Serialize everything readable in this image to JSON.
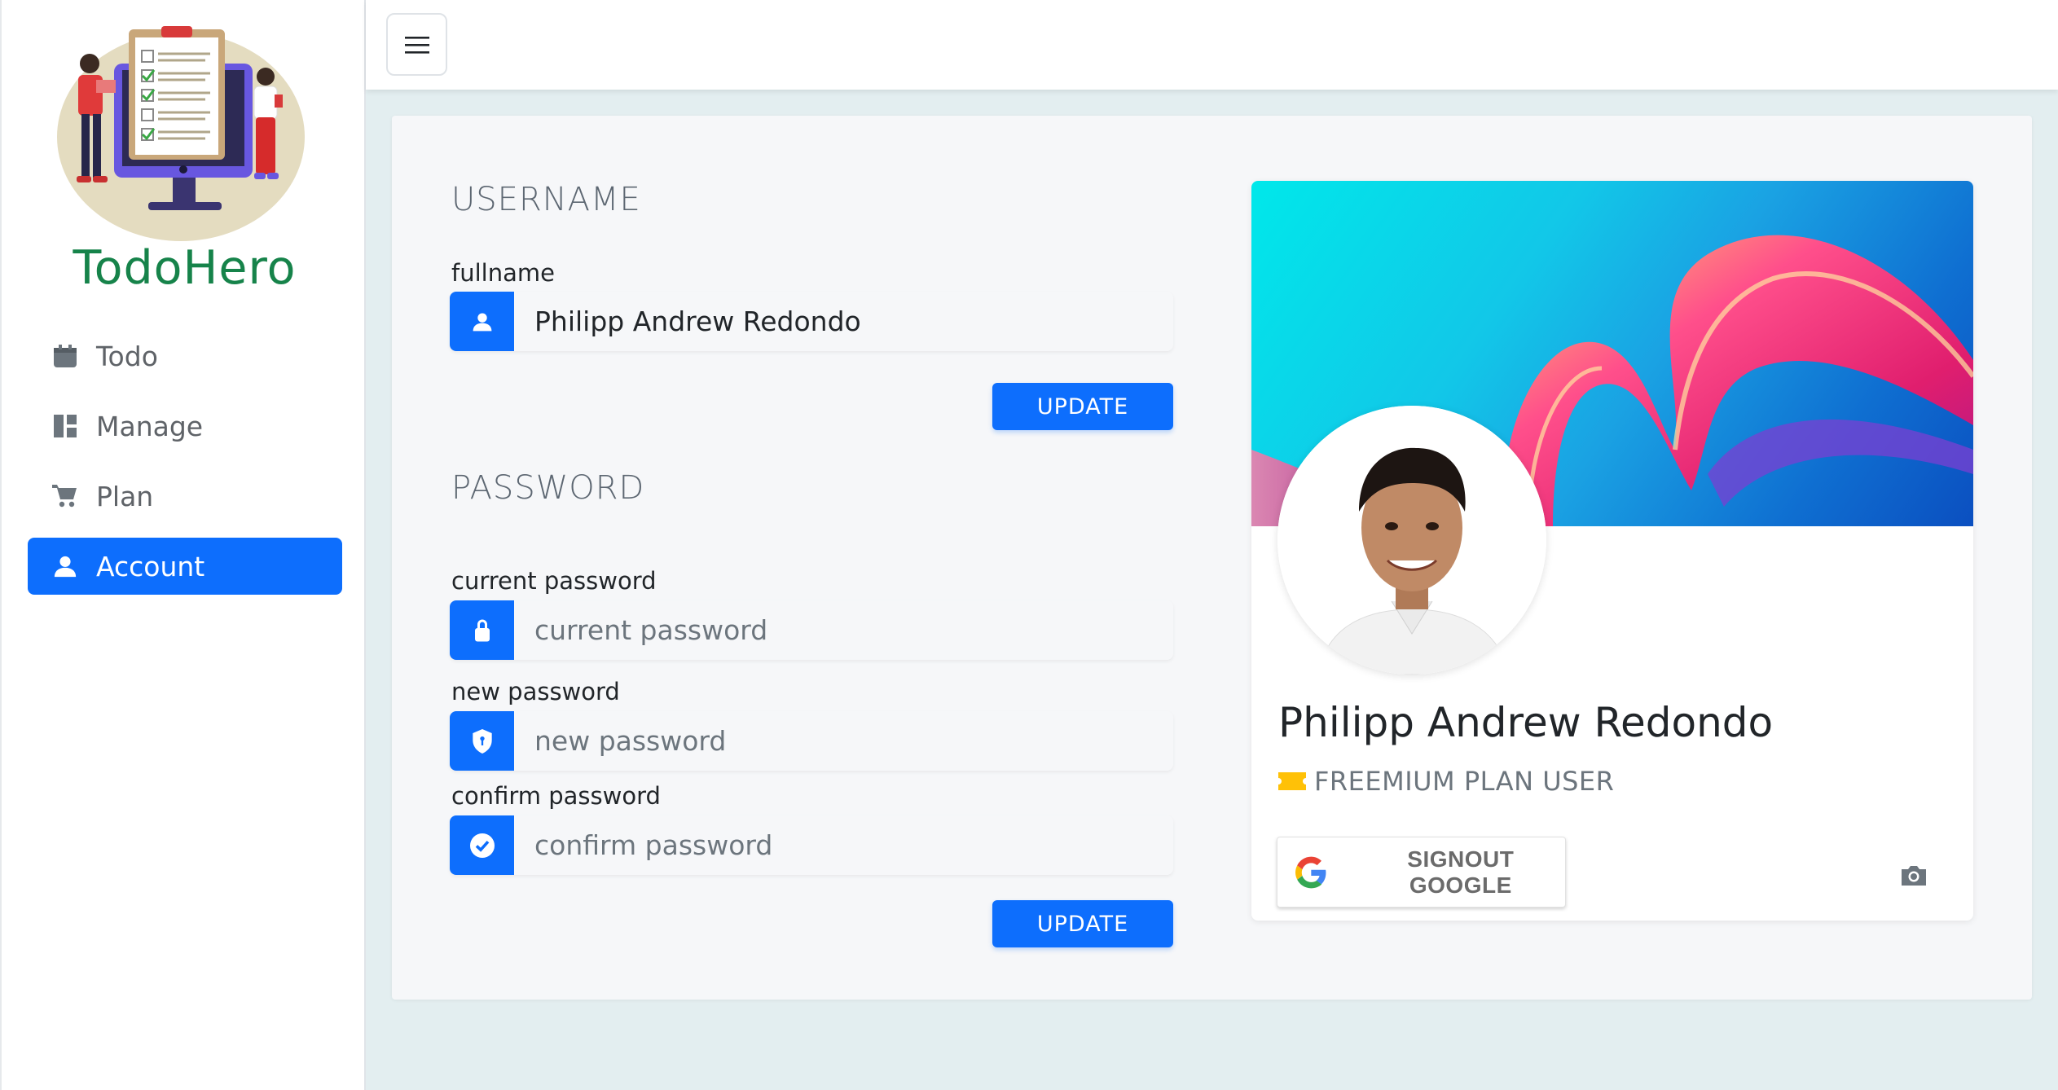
{
  "brand": {
    "name": "TodoHero"
  },
  "sidebar": {
    "items": [
      {
        "label": "Todo",
        "icon": "calendar-icon",
        "active": false
      },
      {
        "label": "Manage",
        "icon": "dashboard-icon",
        "active": false
      },
      {
        "label": "Plan",
        "icon": "cart-icon",
        "active": false
      },
      {
        "label": "Account",
        "icon": "person-icon",
        "active": true
      }
    ]
  },
  "topbar": {
    "menu_icon": "hamburger-icon"
  },
  "username_section": {
    "title": "USERNAME",
    "fullname_label": "fullname",
    "fullname_value": "Philipp Andrew Redondo",
    "update_label": "UPDATE"
  },
  "password_section": {
    "title": "PASSWORD",
    "current_label": "current password",
    "current_placeholder": "current password",
    "new_label": "new password",
    "new_placeholder": "new password",
    "confirm_label": "confirm password",
    "confirm_placeholder": "confirm password",
    "update_label": "UPDATE"
  },
  "profile": {
    "name": "Philipp Andrew Redondo",
    "plan": "FREEMIUM PLAN USER",
    "signout_label": "SIGNOUT GOOGLE"
  },
  "colors": {
    "primary": "#0d6efd",
    "brand": "#16834a",
    "background": "#e3eef0"
  }
}
